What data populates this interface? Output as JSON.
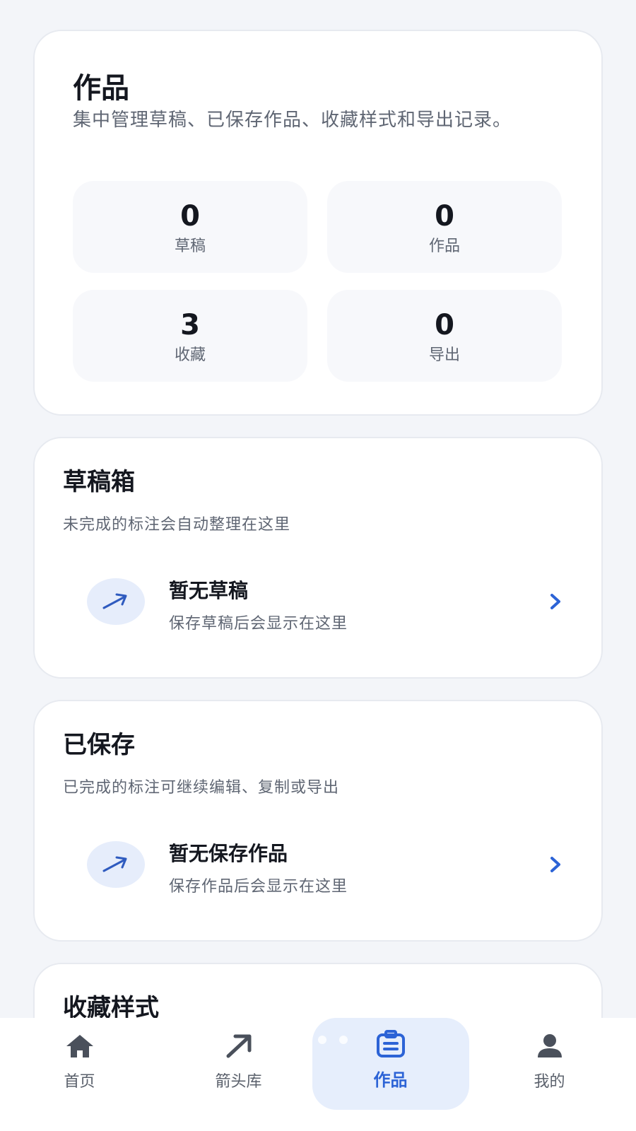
{
  "hero": {
    "title": "作品",
    "subtitle": "集中管理草稿、已保存作品、收藏样式和导出记录。",
    "stats": [
      {
        "value": "0",
        "label": "草稿"
      },
      {
        "value": "0",
        "label": "作品"
      },
      {
        "value": "3",
        "label": "收藏"
      },
      {
        "value": "0",
        "label": "导出"
      }
    ]
  },
  "drafts": {
    "title": "草稿箱",
    "description": "未完成的标注会自动整理在这里",
    "empty_title": "暂无草稿",
    "empty_subtitle": "保存草稿后会显示在这里",
    "icon": "arrow-icon"
  },
  "saved": {
    "title": "已保存",
    "description": "已完成的标注可继续编辑、复制或导出",
    "empty_title": "暂无保存作品",
    "empty_subtitle": "保存作品后会显示在这里",
    "icon": "arrow-icon"
  },
  "favorites": {
    "title": "收藏样式"
  },
  "tabbar": {
    "items": [
      {
        "label": "首页",
        "icon": "home-icon"
      },
      {
        "label": "箭头库",
        "icon": "arrow-library-icon"
      },
      {
        "label": "作品",
        "icon": "works-icon",
        "active": true
      },
      {
        "label": "我的",
        "icon": "profile-icon"
      }
    ]
  },
  "colors": {
    "accent": "#2c63d6",
    "background": "#f3f5f9",
    "card": "#ffffff",
    "active_tab_bg": "#e6eefc"
  }
}
